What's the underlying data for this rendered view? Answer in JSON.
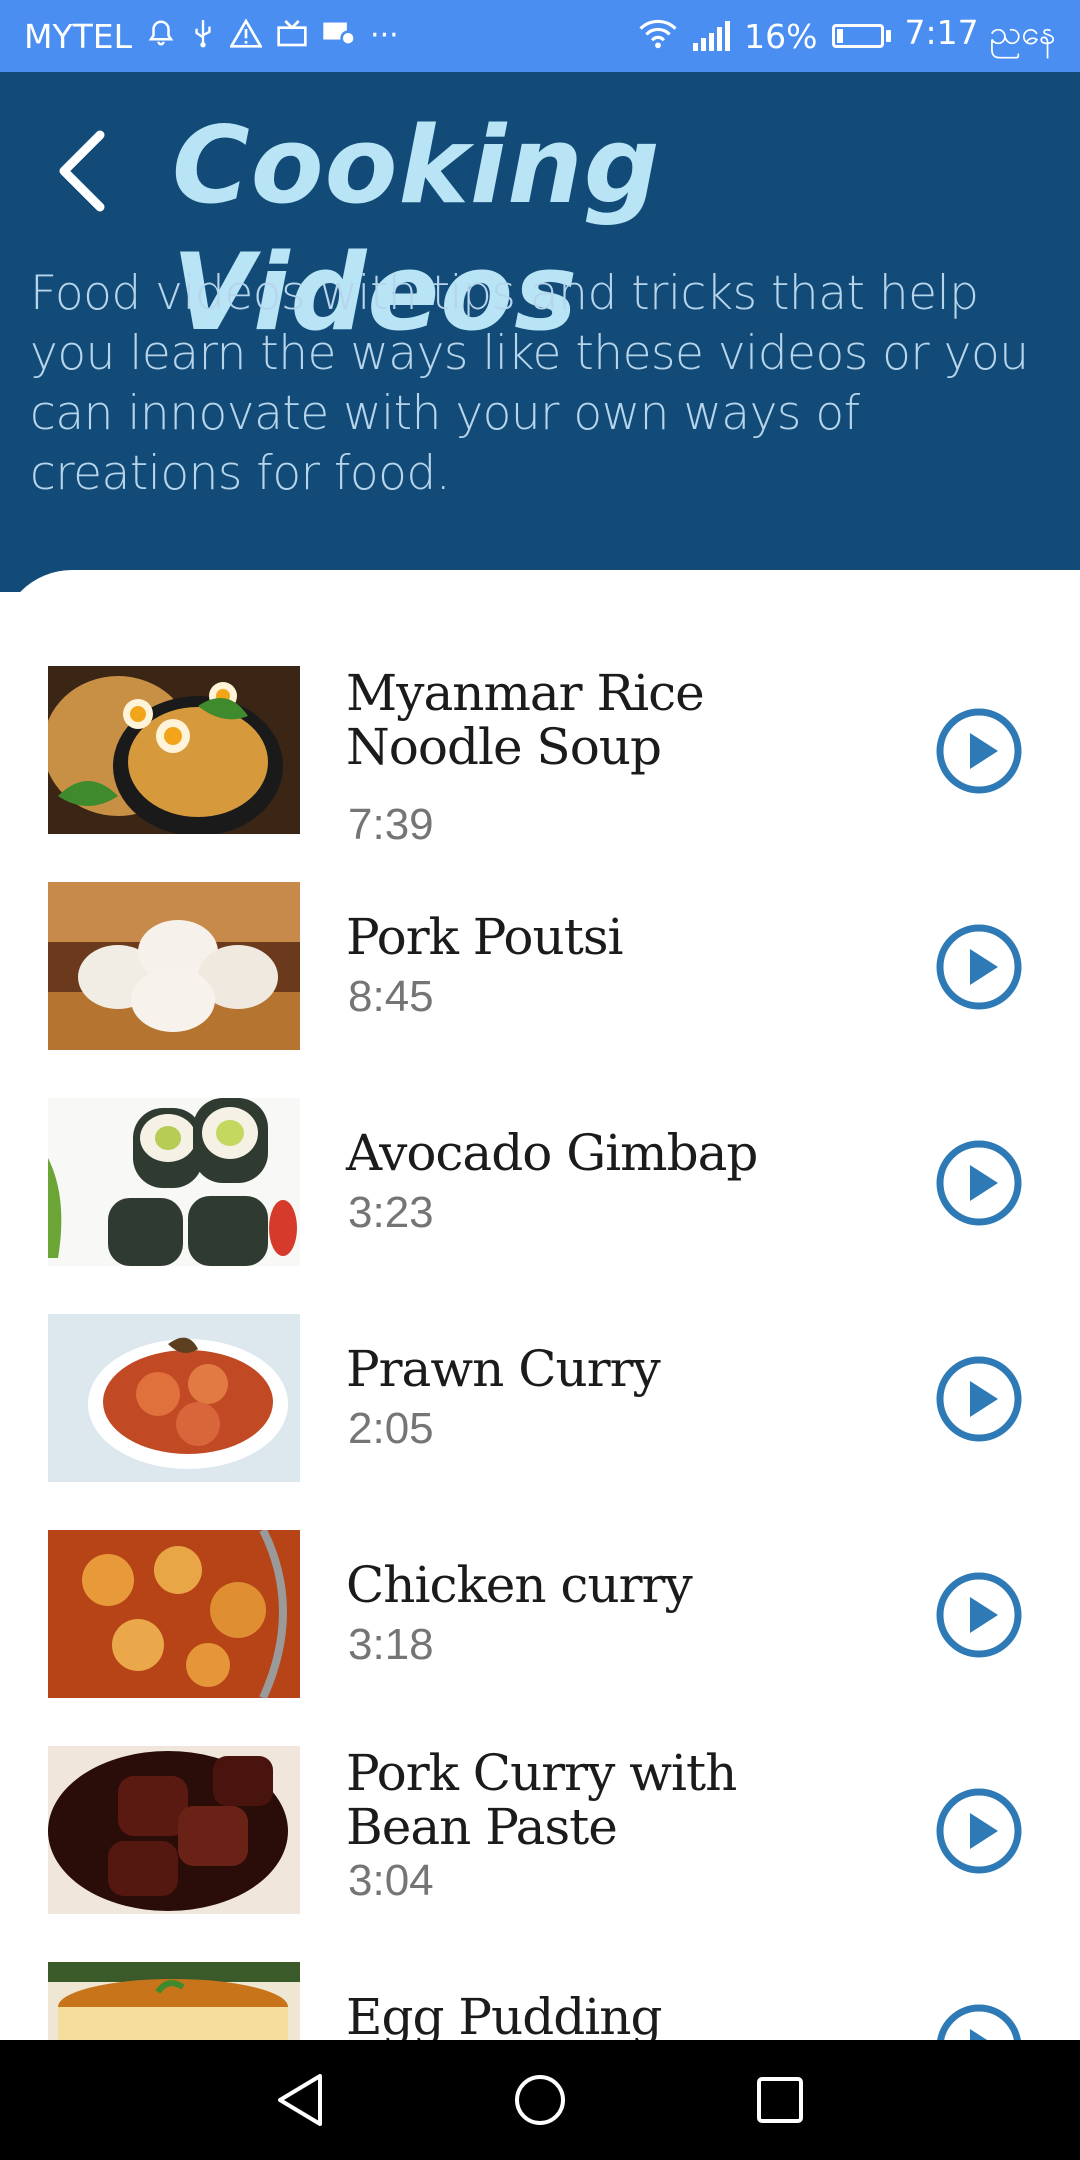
{
  "status_bar": {
    "carrier": "MYTEL",
    "icons": [
      "bell-icon",
      "usb-icon",
      "warning-icon",
      "tv-icon",
      "message-settings-icon",
      "more-icon"
    ],
    "overflow_glyph": "···",
    "battery_percent": "16%",
    "battery_level": 0.16,
    "time": "7:17 ညနေ"
  },
  "header": {
    "back_icon": "chevron-left-icon",
    "title": "Cooking Videos",
    "description": "Food videos with tips and tricks that help you learn the ways like these videos or you can innovate with your own ways of creations for food.",
    "background_color": "#124b78",
    "title_color": "#b8e4f6"
  },
  "videos": [
    {
      "title": "Myanmar Rice Noodle Soup",
      "duration": "7:39",
      "play_icon": "play-circle-icon"
    },
    {
      "title": "Pork Poutsi",
      "duration": "8:45",
      "play_icon": "play-circle-icon"
    },
    {
      "title": "Avocado Gimbap",
      "duration": "3:23",
      "play_icon": "play-circle-icon"
    },
    {
      "title": "Prawn Curry",
      "duration": "2:05",
      "play_icon": "play-circle-icon"
    },
    {
      "title": "Chicken curry",
      "duration": "3:18",
      "play_icon": "play-circle-icon"
    },
    {
      "title": "Pork Curry with Bean Paste",
      "duration": "3:04",
      "play_icon": "play-circle-icon"
    },
    {
      "title": "Egg Pudding",
      "duration": "",
      "play_icon": "play-circle-icon"
    }
  ],
  "accent_color": "#2e7ab6",
  "nav_bar": {
    "buttons": [
      "back-triangle-icon",
      "home-circle-icon",
      "recents-square-icon"
    ]
  }
}
